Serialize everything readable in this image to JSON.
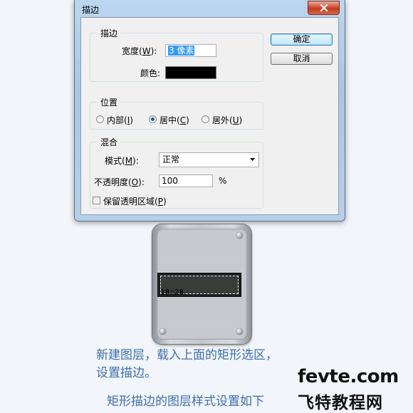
{
  "window": {
    "title": "描边"
  },
  "stroke_group": {
    "title": "描边",
    "width_label_pre": "宽度(",
    "width_label_key": "W",
    "width_label_post": "):",
    "width_value": "3 像素",
    "color_label": "颜色:",
    "color_value": "#000000"
  },
  "position_group": {
    "title": "位置",
    "inside_pre": "内部(",
    "inside_key": "I",
    "inside_post": ")",
    "center_pre": "居中(",
    "center_key": "C",
    "center_post": ")",
    "outside_pre": "居外(",
    "outside_key": "U",
    "outside_post": ")",
    "selected": "center"
  },
  "blend_group": {
    "title": "混合",
    "mode_label_pre": "模式(",
    "mode_label_key": "M",
    "mode_label_post": "):",
    "mode_value": "正常",
    "opacity_label_pre": "不透明度(",
    "opacity_label_key": "O",
    "opacity_label_post": "):",
    "opacity_value": "100",
    "opacity_unit": "%",
    "preserve_pre": "保留透明区域(",
    "preserve_key": "P",
    "preserve_post": ")",
    "preserve_checked": false
  },
  "buttons": {
    "ok": "确定",
    "cancel": "取消"
  },
  "artwork": {
    "time": "18:28"
  },
  "captions": {
    "line1": "新建图层，载入上面的矩形选区，",
    "line2": "设置描边。",
    "line3": "矩形描边的图层样式设置如下"
  },
  "watermark": {
    "site": "fevte.com",
    "name": "飞特教程网"
  },
  "colors": {
    "caption": "#3e6fae",
    "selection": "#3399ff",
    "title_bar": "#bcd6ee"
  }
}
